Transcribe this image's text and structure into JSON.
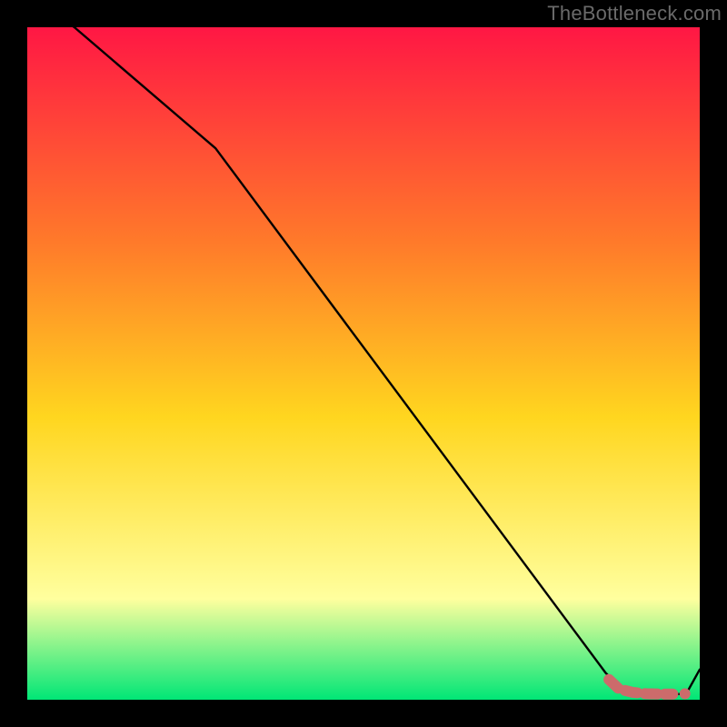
{
  "watermark": "TheBottleneck.com",
  "colors": {
    "background": "#000000",
    "gradient_top": "#ff1744",
    "gradient_mid_upper": "#ff7a2a",
    "gradient_mid": "#ffd61f",
    "gradient_pale": "#ffff9e",
    "gradient_bottom": "#00e676",
    "line": "#000000",
    "marker": "#cc6b6b",
    "watermark": "#6a6a6a"
  },
  "chart_data": {
    "type": "line",
    "title": "",
    "xlabel": "",
    "ylabel": "",
    "xlim": [
      0,
      100
    ],
    "ylim": [
      0,
      100
    ],
    "grid": false,
    "legend": false,
    "series": [
      {
        "name": "curve",
        "x": [
          0,
          7,
          28,
          86,
          88,
          90,
          92,
          94,
          96,
          98,
          100
        ],
        "values": [
          105,
          100,
          82,
          4,
          2,
          1.2,
          0.9,
          0.8,
          0.8,
          0.9,
          4.5
        ]
      }
    ],
    "markers": {
      "name": "highlight-dots",
      "x": [
        86.5,
        88,
        90,
        92,
        94,
        96,
        97.8
      ],
      "values": [
        3.0,
        1.6,
        1.1,
        0.9,
        0.85,
        0.85,
        0.9
      ]
    },
    "annotations": []
  }
}
